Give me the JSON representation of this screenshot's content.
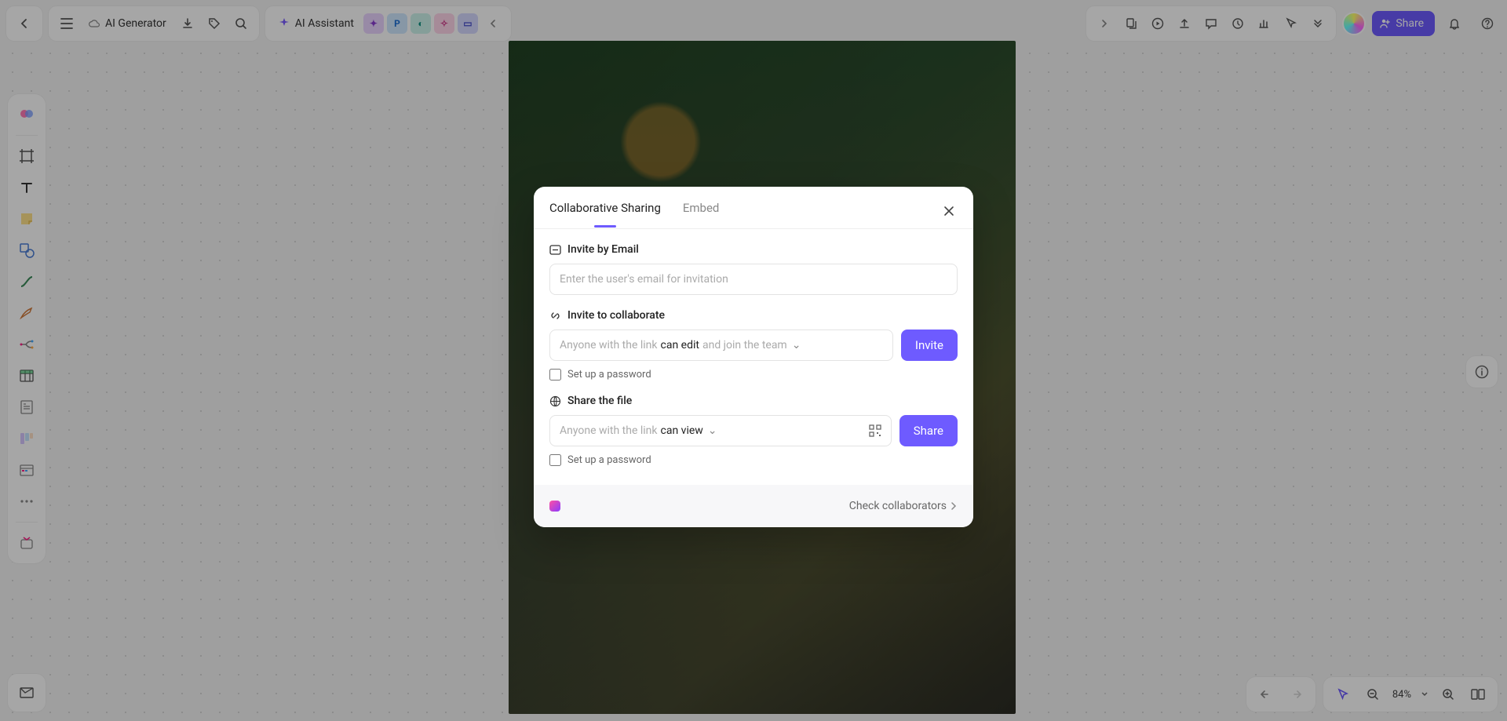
{
  "topbar": {
    "ai_generator": "AI Generator",
    "ai_assistant": "AI Assistant",
    "quick_tools": [
      "",
      "P",
      "",
      "",
      ""
    ],
    "share_label": "Share"
  },
  "footbar": {
    "zoom_label": "84%"
  },
  "modal": {
    "tabs": {
      "share": "Collaborative Sharing",
      "embed": "Embed"
    },
    "invite_email": {
      "title": "Invite by Email",
      "placeholder": "Enter the user's email for invitation"
    },
    "invite_link": {
      "title": "Invite to collaborate",
      "prefix": "Anyone with the link",
      "permission": "can edit",
      "suffix": "and join the team",
      "button": "Invite",
      "password_label": "Set up a password"
    },
    "share_file": {
      "title": "Share the file",
      "prefix": "Anyone with the link",
      "permission": "can view",
      "button": "Share",
      "password_label": "Set up a password"
    },
    "footer_link": "Check collaborators"
  }
}
